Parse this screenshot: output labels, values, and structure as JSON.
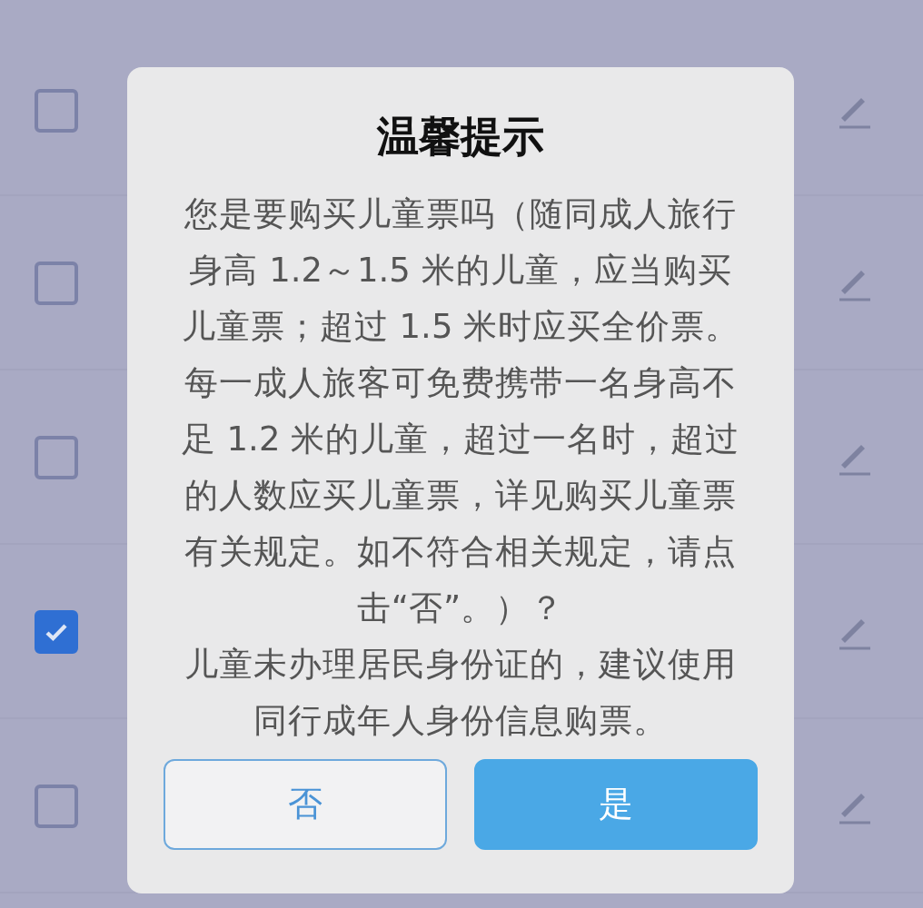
{
  "rows": [
    {
      "checked": false
    },
    {
      "checked": false
    },
    {
      "checked": false
    },
    {
      "checked": true
    },
    {
      "checked": false
    }
  ],
  "dialog": {
    "title": "温馨提示",
    "paragraphs": [
      "您是要购买儿童票吗（随同成人旅行身高 1.2～1.5 米的儿童，应当购买儿童票；超过 1.5 米时应买全价票。每一成人旅客可免费携带一名身高不足 1.2 米的儿童，超过一名时，超过的人数应买儿童票，详见购买儿童票有关规定。如不符合相关规定，请点击“否”。）？",
      "儿童未办理居民身份证的，建议使用同行成年人身份信息购票。"
    ],
    "buttons": [
      {
        "label": "否",
        "kind": "secondary"
      },
      {
        "label": "是",
        "kind": "primary"
      }
    ]
  }
}
